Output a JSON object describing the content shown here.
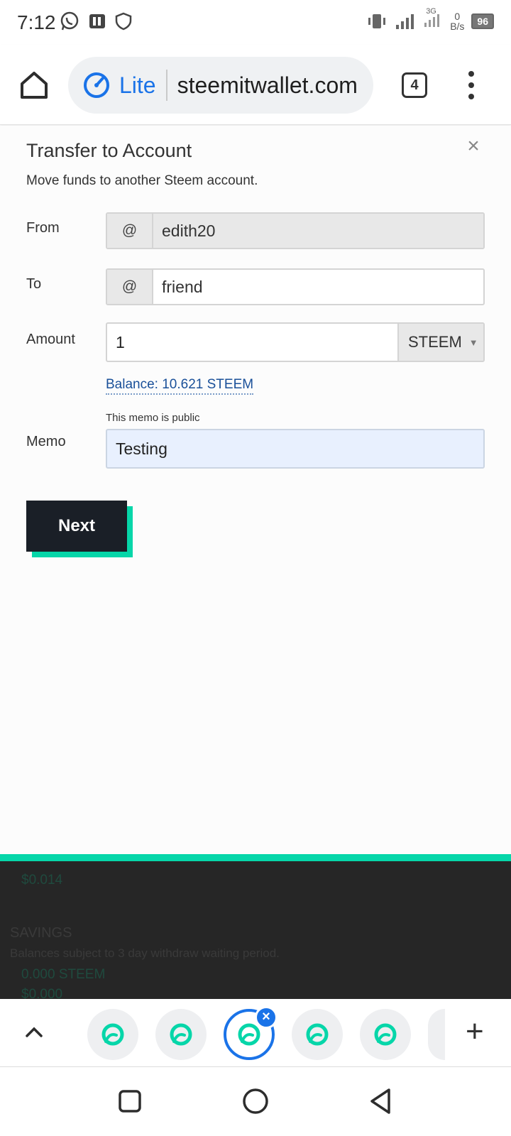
{
  "status_bar": {
    "time": "7:12",
    "net_speed_value": "0",
    "net_speed_unit": "B/s",
    "network_type": "3G",
    "battery": "96"
  },
  "browser": {
    "mode_label": "Lite",
    "url": "steemitwallet.com",
    "tab_count": "4",
    "accent_color": "#1a73e8"
  },
  "dialog": {
    "title": "Transfer to Account",
    "subtitle": "Move funds to another Steem account.",
    "close_glyph": "×",
    "from": {
      "label": "From",
      "prefix": "@",
      "value": "edith20"
    },
    "to": {
      "label": "To",
      "prefix": "@",
      "value": "friend"
    },
    "amount": {
      "label": "Amount",
      "value": "1",
      "currency": "STEEM"
    },
    "balance": "Balance: 10.621 STEEM",
    "memo": {
      "label": "Memo",
      "note": "This memo is public",
      "value": "Testing"
    },
    "next_label": "Next",
    "button_accent": "#06d6a9"
  },
  "background_page": {
    "value_1": "$0.014",
    "section_title": "SAVINGS",
    "section_note": "Balances subject to 3 day withdraw waiting period.",
    "savings_steem": "0.000 STEEM",
    "savings_usd": "$0.000"
  },
  "tab_strip": {
    "tabs": [
      {
        "icon": "steemit-icon",
        "active": false
      },
      {
        "icon": "steemit-icon",
        "active": false
      },
      {
        "icon": "steemit-icon",
        "active": true
      },
      {
        "icon": "steemit-icon",
        "active": false
      },
      {
        "icon": "steemit-icon",
        "active": false
      }
    ],
    "new_tab_glyph": "+"
  }
}
